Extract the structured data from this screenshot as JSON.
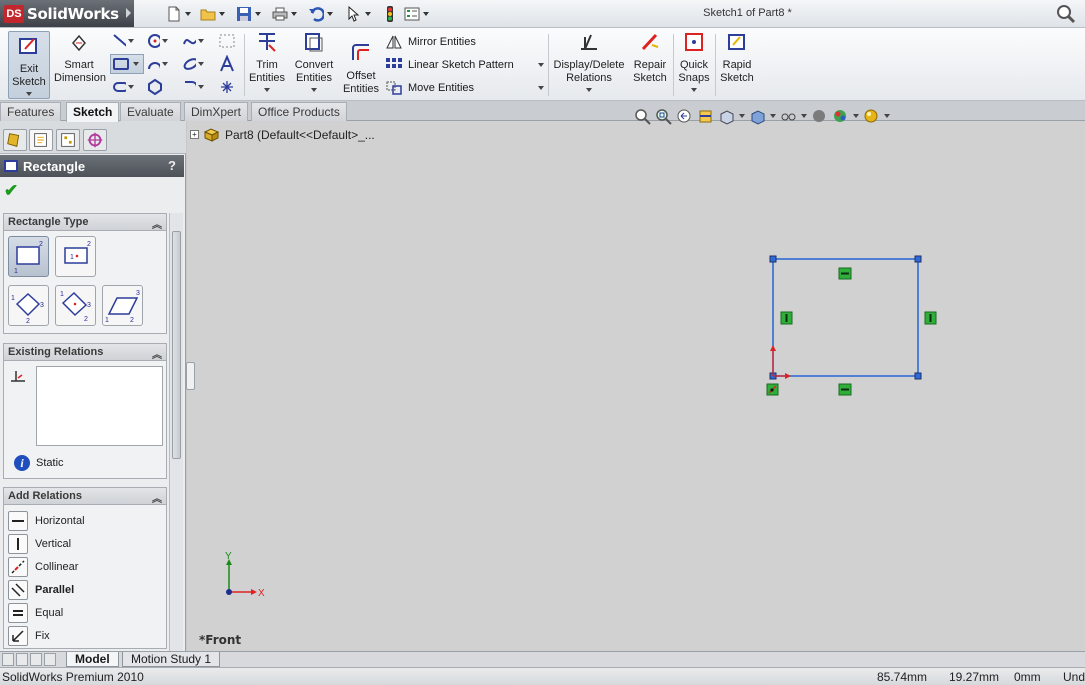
{
  "app": {
    "name": "SolidWorks",
    "logo_mark": "DS"
  },
  "window": {
    "title": "Sketch1 of Part8 *"
  },
  "quick_access": [
    "new-icon",
    "open-icon",
    "save-icon",
    "print-icon",
    "undo-icon",
    "select-icon",
    "rebuild-icon",
    "options-icon"
  ],
  "ribbon": {
    "exit_sketch": "Exit Sketch",
    "smart_dimension": "Smart Dimension",
    "trim_entities": "Trim Entities",
    "convert_entities": "Convert Entities",
    "offset_entities": "Offset Entities",
    "mirror_entities": "Mirror Entities",
    "linear_sketch_pattern": "Linear Sketch Pattern",
    "move_entities": "Move Entities",
    "display_delete_relations": "Display/Delete Relations",
    "repair_sketch": "Repair Sketch",
    "quick_snaps": "Quick Snaps",
    "rapid_sketch": "Rapid Sketch"
  },
  "tabs": [
    "Features",
    "Sketch",
    "Evaluate",
    "DimXpert",
    "Office Products"
  ],
  "active_tab": "Sketch",
  "property_manager": {
    "title": "Rectangle",
    "help": "?",
    "rectangle_type": {
      "header": "Rectangle Type"
    },
    "existing_relations": {
      "header": "Existing Relations",
      "status": "Static"
    },
    "add_relations": {
      "header": "Add Relations",
      "items": [
        "Horizontal",
        "Vertical",
        "Collinear",
        "Parallel",
        "Equal",
        "Fix"
      ],
      "highlighted": "Parallel"
    }
  },
  "tree": {
    "label": "Part8  (Default<<Default>_..."
  },
  "view": {
    "name": "*Front"
  },
  "triad": {
    "x": "X",
    "y": "Y"
  },
  "bottom_tabs": [
    "Model",
    "Motion Study 1"
  ],
  "status": {
    "product": "SolidWorks Premium 2010",
    "x": "85.74mm",
    "y": "19.27mm",
    "z": "0mm",
    "state": "Und"
  },
  "colors": {
    "sketch_line": "#2f6bd6",
    "relation_badge": "#2fae3a",
    "title_dark": "#4a4f56"
  }
}
